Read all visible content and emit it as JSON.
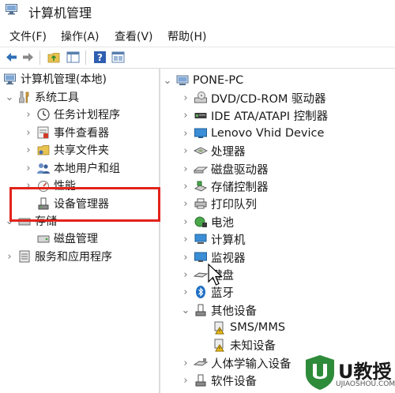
{
  "window": {
    "title": "计算机管理"
  },
  "menu": [
    "文件(F)",
    "操作(A)",
    "查看(V)",
    "帮助(H)"
  ],
  "toolbar": [
    "back-arrow-icon",
    "forward-arrow-icon",
    "folder-up-icon",
    "show-hide-tree-icon",
    "help-icon",
    "properties-icon"
  ],
  "tree": {
    "root": "计算机管理(本地)",
    "system_tools": "系统工具",
    "task_scheduler": "任务计划程序",
    "event_viewer": "事件查看器",
    "shared_folders": "共享文件夹",
    "local_users": "本地用户和组",
    "performance": "性能",
    "device_manager": "设备管理器",
    "storage": "存储",
    "disk_management": "磁盘管理",
    "services_apps": "服务和应用程序"
  },
  "devices": {
    "computer": "PONE-PC",
    "items": [
      "DVD/CD-ROM 驱动器",
      "IDE ATA/ATAPI 控制器",
      "Lenovo Vhid Device",
      "处理器",
      "磁盘驱动器",
      "存储控制器",
      "打印队列",
      "电池",
      "计算机",
      "监视器",
      "键盘",
      "蓝牙",
      "其他设备",
      "SMS/MMS",
      "未知设备",
      "人体学输入设备",
      "软件设备"
    ]
  },
  "watermark": {
    "brand": "U教授",
    "site": "UJIAOSHOU.COM"
  },
  "colors": {
    "highlight_box": "#e2231a",
    "watermark_green": "#2e8b3a"
  }
}
